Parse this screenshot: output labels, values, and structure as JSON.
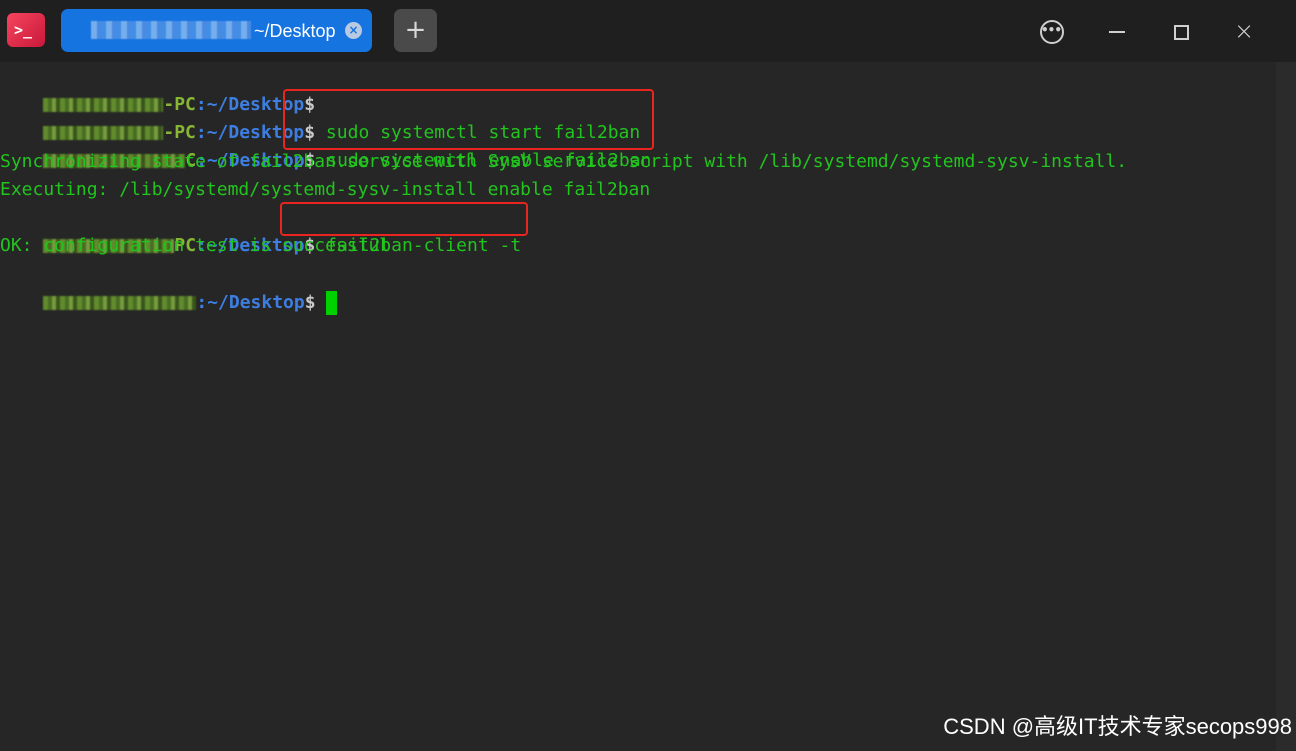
{
  "window": {
    "app_icon": ">_",
    "tab": {
      "title": "~/Desktop",
      "close_label": "×"
    },
    "add_tab_label": "+",
    "controls": {
      "menu_label": "•••",
      "close_label": "×"
    }
  },
  "terminal": {
    "lines": [
      {
        "host": "-PC",
        "path": ":~/Desktop",
        "dollar": "$",
        "command": ""
      },
      {
        "host": "-PC",
        "path": ":~/Desktop",
        "dollar": "$",
        "command": " sudo systemctl start fail2ban"
      },
      {
        "host": "C",
        "path": ":~/Desktop",
        "dollar": "$",
        "command": " sudo systemctl enable fail2ban"
      },
      {
        "output": "Synchronizing state of fail2ban.service with SysV service script with /lib/systemd/systemd-sysv-install."
      },
      {
        "output": "Executing: /lib/systemd/systemd-sysv-install enable fail2ban"
      },
      {
        "host": "PC",
        "path": ":~/Desktop",
        "dollar": "$",
        "command": " fail2ban-client -t"
      },
      {
        "output": "OK: configuration test is successful"
      },
      {
        "host": "",
        "path": ":~/Desktop",
        "dollar": "$",
        "command": " "
      }
    ]
  },
  "watermark": "CSDN @高级IT技术专家secops998",
  "colors": {
    "accent_tab": "#1674e0",
    "terminal_green": "#22c41e",
    "path_blue": "#3d7ee0",
    "highlight_red": "#e8261f"
  }
}
